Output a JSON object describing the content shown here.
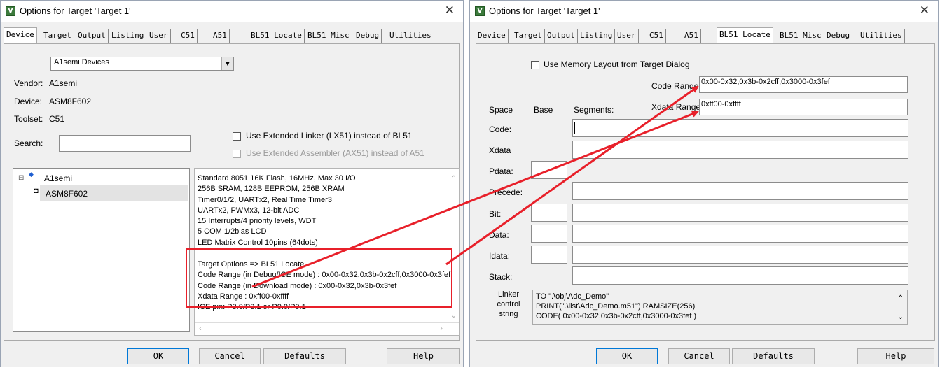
{
  "left": {
    "title": "Options for Target 'Target 1'",
    "tabs": [
      "Device",
      "Target",
      "Output",
      "Listing",
      "User",
      "C51",
      "A51",
      "BL51 Locate",
      "BL51 Misc",
      "Debug",
      "Utilities"
    ],
    "device_db": "A1semi Devices",
    "vendor_label": "Vendor:",
    "vendor": "A1semi",
    "device_label": "Device:",
    "device": "ASM8F602",
    "toolset_label": "Toolset:",
    "toolset": "C51",
    "search_label": "Search:",
    "search_value": "",
    "opt_lx51": "Use Extended Linker (LX51) instead of BL51",
    "opt_ax51": "Use Extended Assembler (AX51) instead of A51",
    "tree_root": "A1semi",
    "tree_child": "ASM8F602",
    "desc_lines": [
      "Standard 8051 16K Flash, 16MHz, Max 30 I/O",
      "256B SRAM, 128B EEPROM, 256B XRAM",
      "Timer0/1/2, UARTx2, Real Time Timer3",
      "UARTx2, PWMx3, 12-bit ADC",
      "15 Interrupts/4 priority levels, WDT",
      "5 COM 1/2bias LCD",
      "LED Matrix Control 10pins (64dots)"
    ],
    "desc_lines2": [
      "Target Options => BL51 Locate",
      "Code Range (in Debug/ICE mode) : 0x00-0x32,0x3b-0x2cff,0x3000-0x3fef",
      "Code Range (in Download mode) : 0x00-0x32,0x3b-0x3fef",
      "Xdata Range : 0xff00-0xffff",
      "ICE pin: P3.0/P3.1 or P0.0/P0.1"
    ],
    "buttons": {
      "ok": "OK",
      "cancel": "Cancel",
      "defaults": "Defaults",
      "help": "Help"
    }
  },
  "right": {
    "title": "Options for Target 'Target 1'",
    "tabs": [
      "Device",
      "Target",
      "Output",
      "Listing",
      "User",
      "C51",
      "A51",
      "BL51 Locate",
      "BL51 Misc",
      "Debug",
      "Utilities"
    ],
    "use_memory_layout": "Use Memory Layout from Target Dialog",
    "code_range_label": "Code Range:",
    "code_range": "0x00-0x32,0x3b-0x2cff,0x3000-0x3fef",
    "xdata_range_label": "Xdata Range:",
    "xdata_range": "0xff00-0xffff",
    "col_space": "Space",
    "col_base": "Base",
    "col_segments": "Segments:",
    "rows": [
      "Code:",
      "Xdata",
      "Pdata:",
      "Precede:",
      "Bit:",
      "Data:",
      "Idata:",
      "Stack:"
    ],
    "linker_label": [
      "Linker",
      "control",
      "string"
    ],
    "linker_lines": [
      "TO \".\\obj\\Adc_Demo\"",
      "PRINT(\".\\list\\Adc_Demo.m51\") RAMSIZE(256)",
      "CODE( 0x00-0x32,0x3b-0x2cff,0x3000-0x3fef )"
    ],
    "buttons": {
      "ok": "OK",
      "cancel": "Cancel",
      "defaults": "Defaults",
      "help": "Help"
    }
  },
  "colors": {
    "annotation_red": "#e8202a",
    "title_text": "#000000",
    "dialog_bg": "#f0f0f0"
  }
}
